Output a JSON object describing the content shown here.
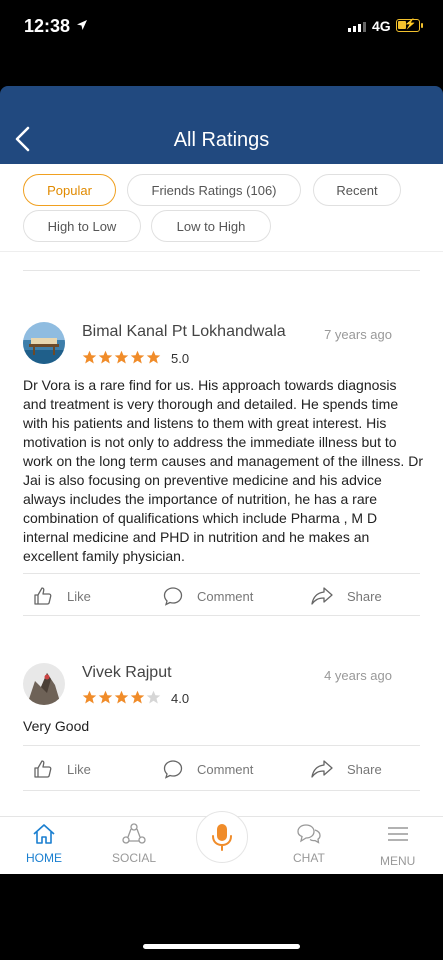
{
  "status_bar": {
    "time": "12:38",
    "network": "4G"
  },
  "header": {
    "title": "All Ratings"
  },
  "filters": [
    {
      "label": "Popular",
      "active": true
    },
    {
      "label": "Friends Ratings (106)",
      "active": false
    },
    {
      "label": "Recent",
      "active": false
    },
    {
      "label": "High to Low",
      "active": false
    },
    {
      "label": "Low to High",
      "active": false
    }
  ],
  "actions": {
    "like": "Like",
    "comment": "Comment",
    "share": "Share"
  },
  "reviews": [
    {
      "name": "Bimal Kanal Pt Lokhandwala",
      "time": "7 years ago",
      "stars": 5,
      "rating": "5.0",
      "text": "Dr Vora is a rare find for us. His approach towards diagnosis and treatment is very thorough and detailed. He spends time with his patients and listens to them with great interest. His motivation is not only to address the immediate illness but to work on the long term causes and management of the illness. Dr Jai is also focusing on preventive medicine and his advice always includes the importance of nutrition, he has a rare combination of qualifications which include Pharma , M D internal medicine and PHD in nutrition and he makes an excellent family physician."
    },
    {
      "name": "Vivek Rajput",
      "time": "4 years ago",
      "stars": 4,
      "rating": "4.0",
      "text": "Very Good"
    }
  ],
  "tabbar": {
    "home": "HOME",
    "social": "SOCIAL",
    "chat": "CHAT",
    "menu": "MENU"
  },
  "colors": {
    "header": "#21497f",
    "accent": "#f0a020",
    "star": "#f08c2a",
    "tab_active": "#1a7fd0"
  }
}
